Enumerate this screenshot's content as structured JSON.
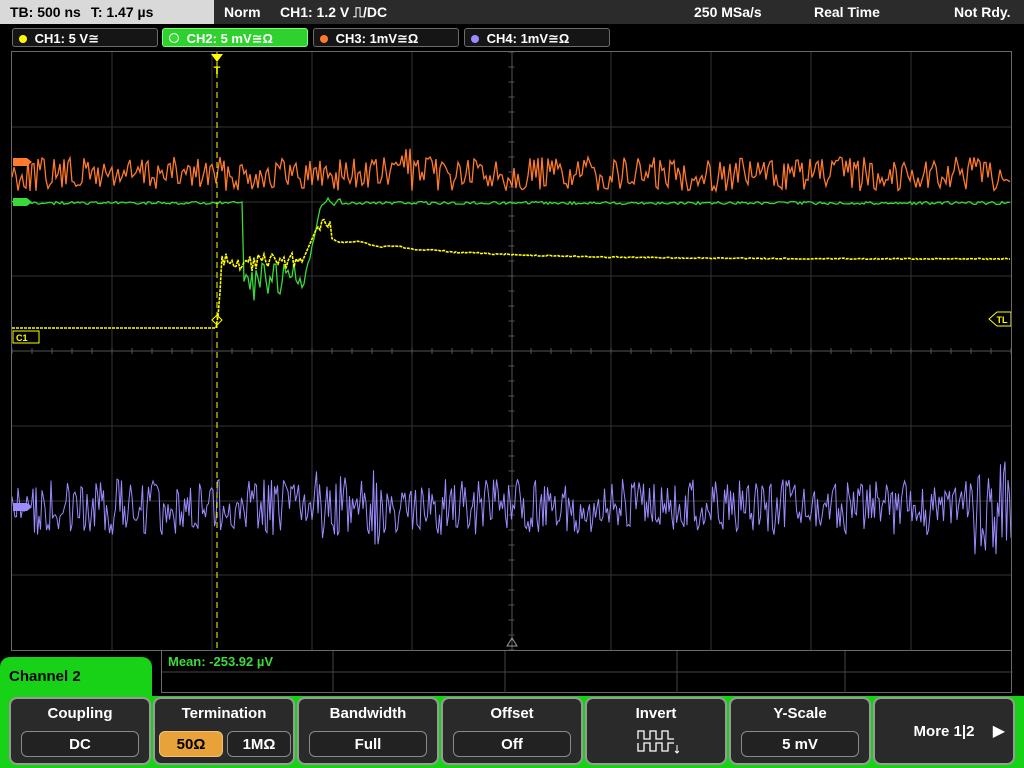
{
  "status_bar": {
    "tb": "TB: 500 ns",
    "t": "T: 1.47 µs",
    "mode": "Norm",
    "trigger": "CH1: 1.2 V ⎍/DC",
    "sample_rate": "250 MSa/s",
    "acq_mode": "Real Time",
    "status": "Not Rdy."
  },
  "channels": [
    {
      "id": "ch1",
      "label": "CH1: 5 V≅",
      "color": "#ffff00",
      "active": false
    },
    {
      "id": "ch2",
      "label": "CH2: 5 mV≅Ω",
      "color": "#39d939",
      "active": true
    },
    {
      "id": "ch3",
      "label": "CH3: 1mV≅Ω",
      "color": "#ff7a2a",
      "active": false
    },
    {
      "id": "ch4",
      "label": "CH4: 1mV≅Ω",
      "color": "#9a8cff",
      "active": false
    }
  ],
  "markers": {
    "trigger_marker": "T",
    "trigger_level": "TL",
    "ch1_ref": "C1"
  },
  "measurement": {
    "mean": "Mean: -253.92 µV"
  },
  "menu": {
    "tab_label": "Channel 2",
    "softkeys": [
      {
        "title": "Coupling",
        "value": "DC"
      },
      {
        "title": "Termination",
        "options": [
          "50Ω",
          "1MΩ"
        ],
        "selected": "50Ω"
      },
      {
        "title": "Bandwidth",
        "value": "Full"
      },
      {
        "title": "Offset",
        "value": "Off"
      },
      {
        "title": "Invert",
        "icon": "invert-waveform-icon"
      },
      {
        "title": "Y-Scale",
        "value": "5 mV"
      }
    ],
    "more": "More 1|2",
    "more_arrow_icon": "triangle-right-icon"
  },
  "colors": {
    "ch1": "#ffff00",
    "ch2": "#39d939",
    "ch3": "#ff7a2a",
    "ch4": "#9a8cff",
    "menu_green": "#18d218",
    "termination_selected": "#e8a23a"
  }
}
